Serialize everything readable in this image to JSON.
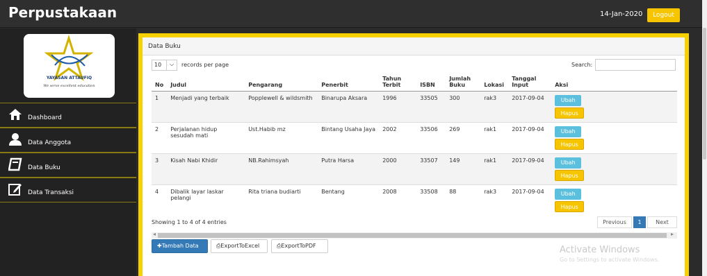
{
  "header": {
    "brand": "Perpustakaan",
    "date": "14-Jan-2020",
    "logout_label": "Logout"
  },
  "logo": {
    "org_name": "YAYASAN ATTAUFIQ",
    "tagline": "We serve excellent education"
  },
  "sidebar": {
    "items": [
      {
        "label": "Dashboard",
        "icon": "home-icon"
      },
      {
        "label": "Data Anggota",
        "icon": "user-icon"
      },
      {
        "label": "Data Buku",
        "icon": "book-icon"
      },
      {
        "label": "Data Transaksi",
        "icon": "edit-icon"
      }
    ]
  },
  "panel": {
    "title": "Data Buku",
    "length_value": "10",
    "length_label": "records per page",
    "search_label": "Search:",
    "info": "Showing 1 to 4 of 4 entries",
    "pagination": {
      "previous": "Previous",
      "current": "1",
      "next": "Next"
    }
  },
  "table": {
    "headers": [
      "No",
      "Judul",
      "Pengarang",
      "Penerbit",
      "Tahun Terbit",
      "ISBN",
      "Jumlah Buku",
      "Lokasi",
      "Tanggal Input",
      "Aksi"
    ],
    "rows": [
      [
        "1",
        "Menjadi yang terbaik",
        "Popplewell & wildsmith",
        "Binarupa Aksara",
        "1996",
        "33505",
        "300",
        "rak3",
        "2017-09-04"
      ],
      [
        "2",
        "Perjalanan hidup sesudah mati",
        "Ust.Habib mz",
        "Bintang Usaha Jaya",
        "2002",
        "33506",
        "269",
        "rak1",
        "2017-09-04"
      ],
      [
        "3",
        "Kisah Nabi Khidir",
        "NB.Rahimsyah",
        "Putra Harsa",
        "2000",
        "33507",
        "149",
        "rak1",
        "2017-09-04"
      ],
      [
        "4",
        "Dibalik layar laskar pelangi",
        "Rita triana budiarti",
        "Bentang",
        "2008",
        "33508",
        "88",
        "rak3",
        "2017-09-04"
      ]
    ],
    "action_edit": "Ubah",
    "action_delete": "Hapus"
  },
  "actions": {
    "add": "Tambah Data",
    "export_excel": "ExportToExcel",
    "export_pdf": "ExportToPDF"
  },
  "watermark": {
    "line1": "Activate Windows",
    "line2": "Go to Settings to activate Windows."
  },
  "colors": {
    "accent": "#f7d000",
    "primary": "#337ab7",
    "info": "#5bc0de",
    "sidebar": "#222222"
  }
}
